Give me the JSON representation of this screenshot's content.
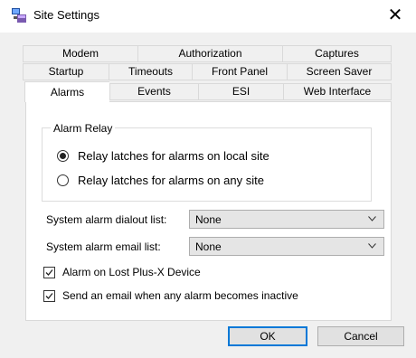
{
  "window": {
    "title": "Site Settings",
    "close_glyph": "✕"
  },
  "tabs": {
    "row1": [
      "Modem",
      "Authorization",
      "Captures"
    ],
    "row2": [
      "Startup",
      "Timeouts",
      "Front Panel",
      "Screen Saver"
    ],
    "row3": [
      "Alarms",
      "Events",
      "ESI",
      "Web Interface"
    ],
    "active": "Alarms"
  },
  "alarm_relay": {
    "title": "Alarm Relay",
    "options": [
      {
        "label": "Relay latches for alarms on local site",
        "selected": true
      },
      {
        "label": "Relay latches for alarms on any site",
        "selected": false
      }
    ]
  },
  "fields": {
    "dialout": {
      "label": "System alarm dialout list:",
      "value": "None"
    },
    "email": {
      "label": "System alarm email list:",
      "value": "None"
    }
  },
  "checkboxes": [
    {
      "label": "Alarm on Lost Plus-X Device",
      "checked": true
    },
    {
      "label": "Send an email when any alarm becomes inactive",
      "checked": true
    }
  ],
  "buttons": {
    "ok": "OK",
    "cancel": "Cancel"
  },
  "icons": {
    "app": "site-settings-app-icon",
    "close": "close-icon",
    "dropdown": "chevron-down-icon",
    "check": "checkmark-icon"
  },
  "colors": {
    "accent": "#0078d7",
    "panel_border": "#d9d9d9"
  }
}
